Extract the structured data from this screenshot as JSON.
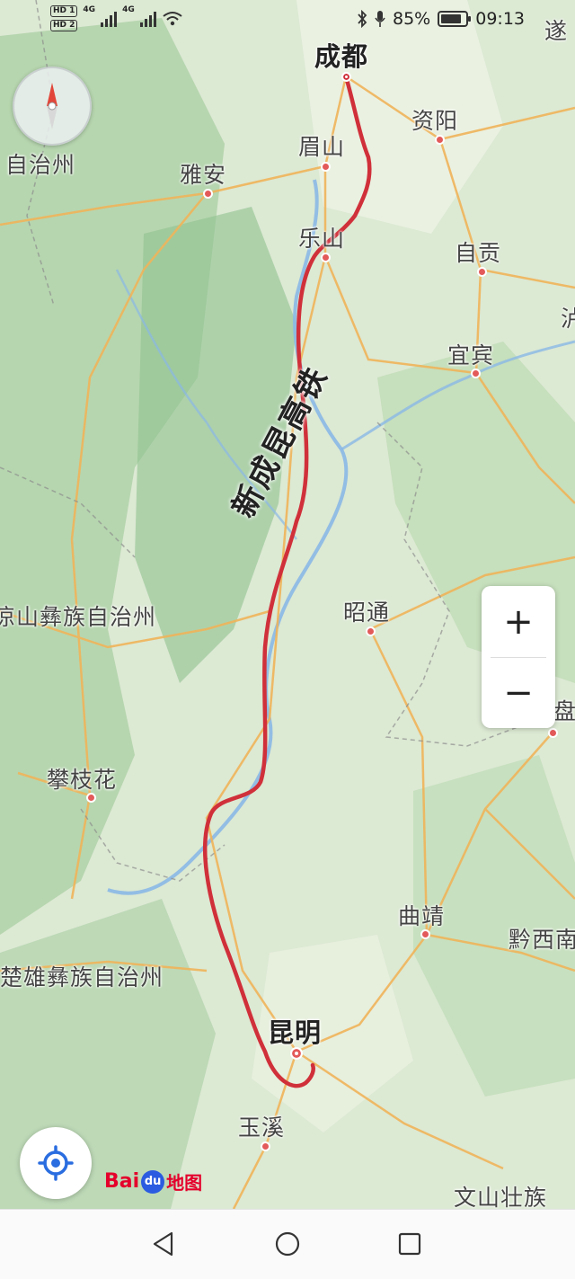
{
  "status_bar": {
    "network_1": "HD 1",
    "network_2": "HD 2",
    "signal_1": "4G",
    "signal_2": "4G",
    "battery_percent": "85%",
    "battery_level": 0.85,
    "time": "09:13"
  },
  "map": {
    "route_label": "新成昆高铁",
    "route_color": "#d0303a",
    "cities": {
      "chengdu": "成都",
      "ziyang": "资阳",
      "meishan": "眉山",
      "yaan": "雅安",
      "leshan": "乐山",
      "zigong": "自贡",
      "yibin": "宜宾",
      "zhaotong": "昭通",
      "panzhihua": "攀枝花",
      "qujing": "曲靖",
      "kunming": "昆明",
      "yuxi": "玉溪"
    },
    "regions": {
      "zizhizhou_top": "自治州",
      "liangshan": "凉山彝族自治州",
      "chuxiong": "楚雄彝族自治州",
      "qianxi": "黔西南",
      "wenshan": "文山壮族",
      "sui_partial": "遂",
      "lu_partial": "泸",
      "pan_partial": "盘"
    }
  },
  "controls": {
    "zoom_in": "+",
    "zoom_out": "−",
    "compass_icon": "compass-icon",
    "locate_icon": "locate-icon"
  },
  "brand": {
    "logo_text_1": "Bai",
    "logo_text_2": "du",
    "logo_text_3": "地图"
  },
  "navigation": {
    "back_icon": "back-triangle-icon",
    "home_icon": "home-circle-icon",
    "recents_icon": "recents-square-icon"
  }
}
